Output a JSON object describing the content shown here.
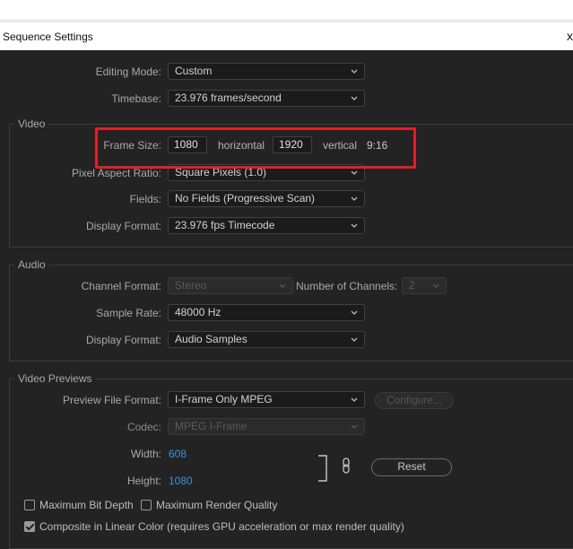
{
  "window": {
    "title": "Sequence Settings",
    "close_glyph": "x"
  },
  "general": {
    "editing_mode_label": "Editing Mode:",
    "editing_mode_value": "Custom",
    "timebase_label": "Timebase:",
    "timebase_value": "23.976  frames/second"
  },
  "video": {
    "section_title": "Video",
    "frame_size_label": "Frame Size:",
    "frame_width": "1080",
    "horizontal_label": "horizontal",
    "frame_height": "1920",
    "vertical_label": "vertical",
    "aspect_ratio": "9:16",
    "pixel_aspect_label": "Pixel Aspect Ratio:",
    "pixel_aspect_value": "Square Pixels (1.0)",
    "fields_label": "Fields:",
    "fields_value": "No Fields (Progressive Scan)",
    "display_format_label": "Display Format:",
    "display_format_value": "23.976 fps Timecode"
  },
  "audio": {
    "section_title": "Audio",
    "channel_format_label": "Channel Format:",
    "channel_format_value": "Stereo",
    "num_channels_label": "Number of Channels:",
    "num_channels_value": "2",
    "sample_rate_label": "Sample Rate:",
    "sample_rate_value": "48000 Hz",
    "display_format_label": "Display Format:",
    "display_format_value": "Audio Samples"
  },
  "previews": {
    "section_title": "Video Previews",
    "preview_format_label": "Preview File Format:",
    "preview_format_value": "I-Frame Only MPEG",
    "configure_label": "Configure...",
    "codec_label": "Codec:",
    "codec_value": "MPEG I-Frame",
    "width_label": "Width:",
    "width_value": "608",
    "height_label": "Height:",
    "height_value": "1080",
    "reset_label": "Reset",
    "max_bit_depth_label": "Maximum Bit Depth",
    "max_bit_depth_checked": false,
    "max_render_quality_label": "Maximum Render Quality",
    "max_render_quality_checked": false,
    "linear_color_label": "Composite in Linear Color (requires GPU acceleration or max render quality)",
    "linear_color_checked": true
  },
  "colors": {
    "highlight": "#e0202a",
    "link_value": "#3d8fe0",
    "panel_bg": "#232323"
  }
}
